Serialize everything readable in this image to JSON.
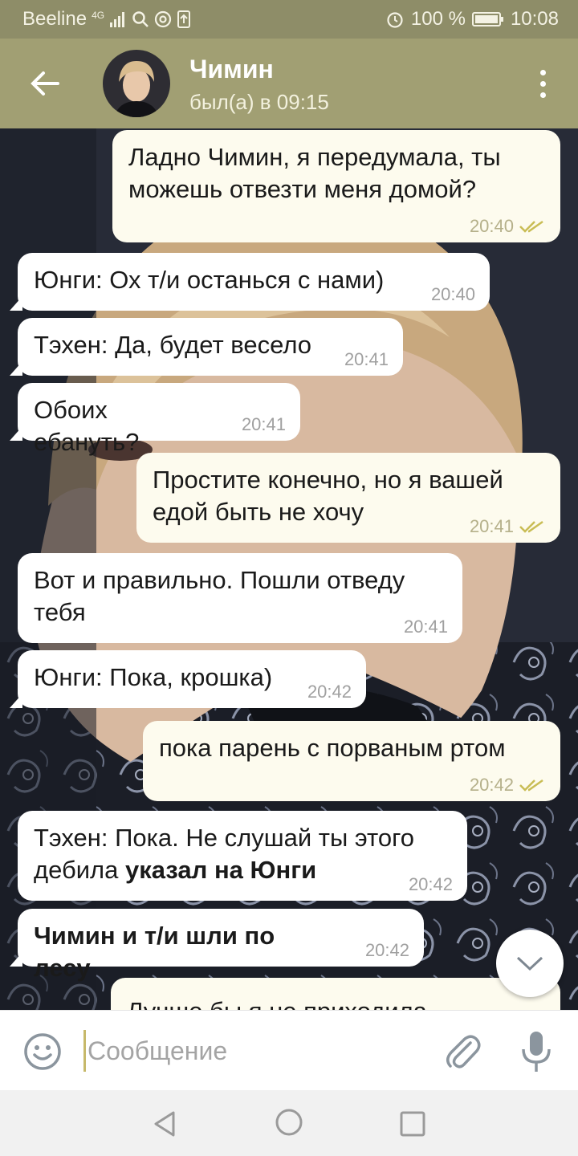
{
  "status_bar": {
    "carrier": "Beeline",
    "network": "4G",
    "battery_percent": "100 %",
    "time": "10:08"
  },
  "header": {
    "contact_name": "Чимин",
    "last_seen": "был(а) в 09:15"
  },
  "messages": [
    {
      "dir": "out",
      "text": "Ладно Чимин, я передумала, ты можешь отвезти меня домой?",
      "time": "20:40",
      "read": true
    },
    {
      "dir": "in",
      "text": "Юнги: Ох т/и останься с нами)",
      "time": "20:40"
    },
    {
      "dir": "in",
      "text": "Тэхен: Да, будет весело",
      "time": "20:41"
    },
    {
      "dir": "in",
      "text": "Обоих ебануть?",
      "time": "20:41"
    },
    {
      "dir": "out",
      "text": "Простите конечно, но я вашей едой быть не хочу",
      "time": "20:41",
      "read": true
    },
    {
      "dir": "in",
      "text": "Вот и правильно. Пошли отведу тебя",
      "time": "20:41"
    },
    {
      "dir": "in",
      "text": "Юнги: Пока, крошка)",
      "time": "20:42"
    },
    {
      "dir": "out",
      "text": "пока парень с порваным ртом",
      "time": "20:42",
      "read": true
    },
    {
      "dir": "in",
      "text": "Тэхен: Пока. Не слушай ты этого дебила",
      "bold_suffix": "указал на Юнги",
      "time": "20:42"
    },
    {
      "dir": "in",
      "bold_text": "Чимин и т/и шли по лесу",
      "time": "20:42"
    },
    {
      "dir": "out",
      "text": "Лучше бы я не приходила"
    }
  ],
  "composer": {
    "placeholder": "Сообщение"
  },
  "icons": {
    "back": "arrow-left-icon",
    "menu": "more-vert-icon",
    "emoji": "smiley-icon",
    "attach": "paperclip-icon",
    "mic": "microphone-icon",
    "scroll_down": "chevron-down-icon"
  },
  "colors": {
    "header": "#a19f73",
    "status_bar": "#8e8d68",
    "outgoing_bubble": "#fdfbee",
    "incoming_bubble": "#ffffff",
    "read_check": "#c9bd55"
  }
}
